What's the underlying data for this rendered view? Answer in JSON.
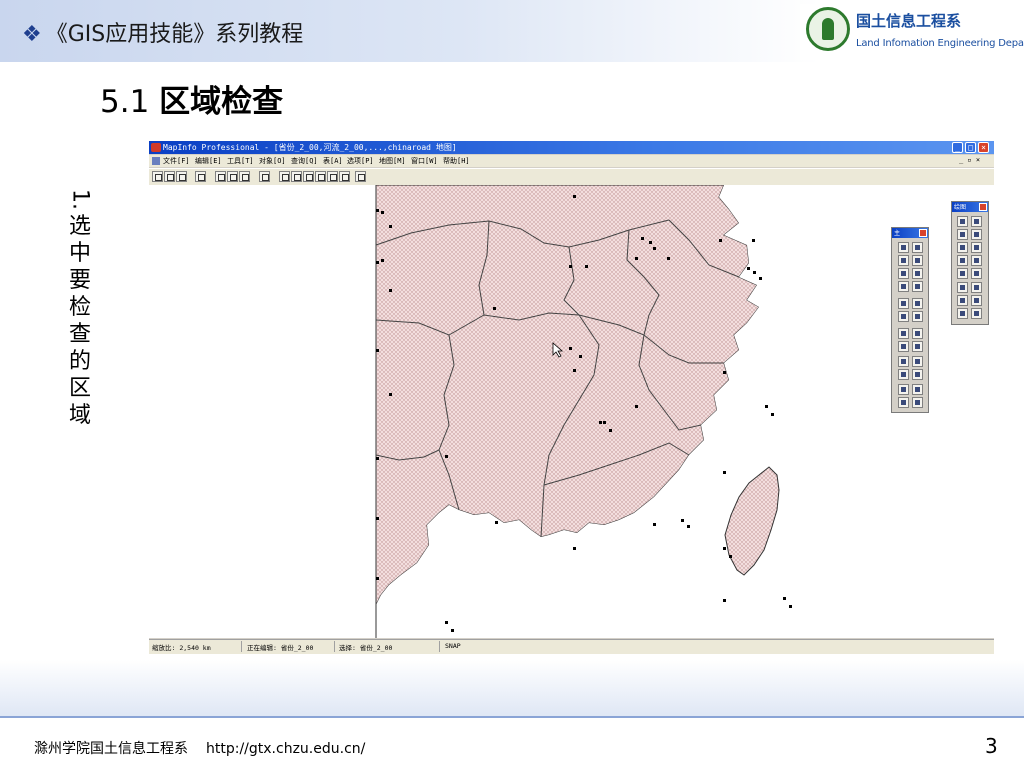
{
  "slide": {
    "course_title": "《GIS应用技能》系列教程",
    "department_cn": "国土信息工程系",
    "department_en": "Land Infomation Engineering Department",
    "section_number": "5.1",
    "section_title": "区域检查",
    "step_label": [
      "1.",
      "选",
      "中",
      "要",
      "检",
      "查",
      "的",
      "区",
      "域"
    ],
    "footer_org": "滁州学院国土信息工程系",
    "footer_url": "http://gtx.chzu.edu.cn/",
    "page_number": "3"
  },
  "app": {
    "window_title": "MapInfo Professional - [省份_2_00,河流_2_00,...,chinaroad 地图]",
    "menu": [
      "文件[F]",
      "编辑[E]",
      "工具[T]",
      "对象[O]",
      "查询[Q]",
      "表[A]",
      "选项[P]",
      "地图[M]",
      "窗口[W]",
      "帮助[H]"
    ],
    "statusbar": {
      "zoom": "缩放比: 2,540 km",
      "editing": "正在编辑: 省份_2_00",
      "selecting": "选择: 省份_2_00",
      "snap": "SNAP"
    },
    "palettes": {
      "main_title": "主",
      "drawing_title": "绘图"
    }
  },
  "colors": {
    "title_bar": "#0a3fc4",
    "region_fill": "#f0dcdc",
    "region_stroke": "#444444",
    "close_button": "#d8432b",
    "dept_green": "#2d7a2d",
    "dept_blue": "#1b4fa0"
  }
}
